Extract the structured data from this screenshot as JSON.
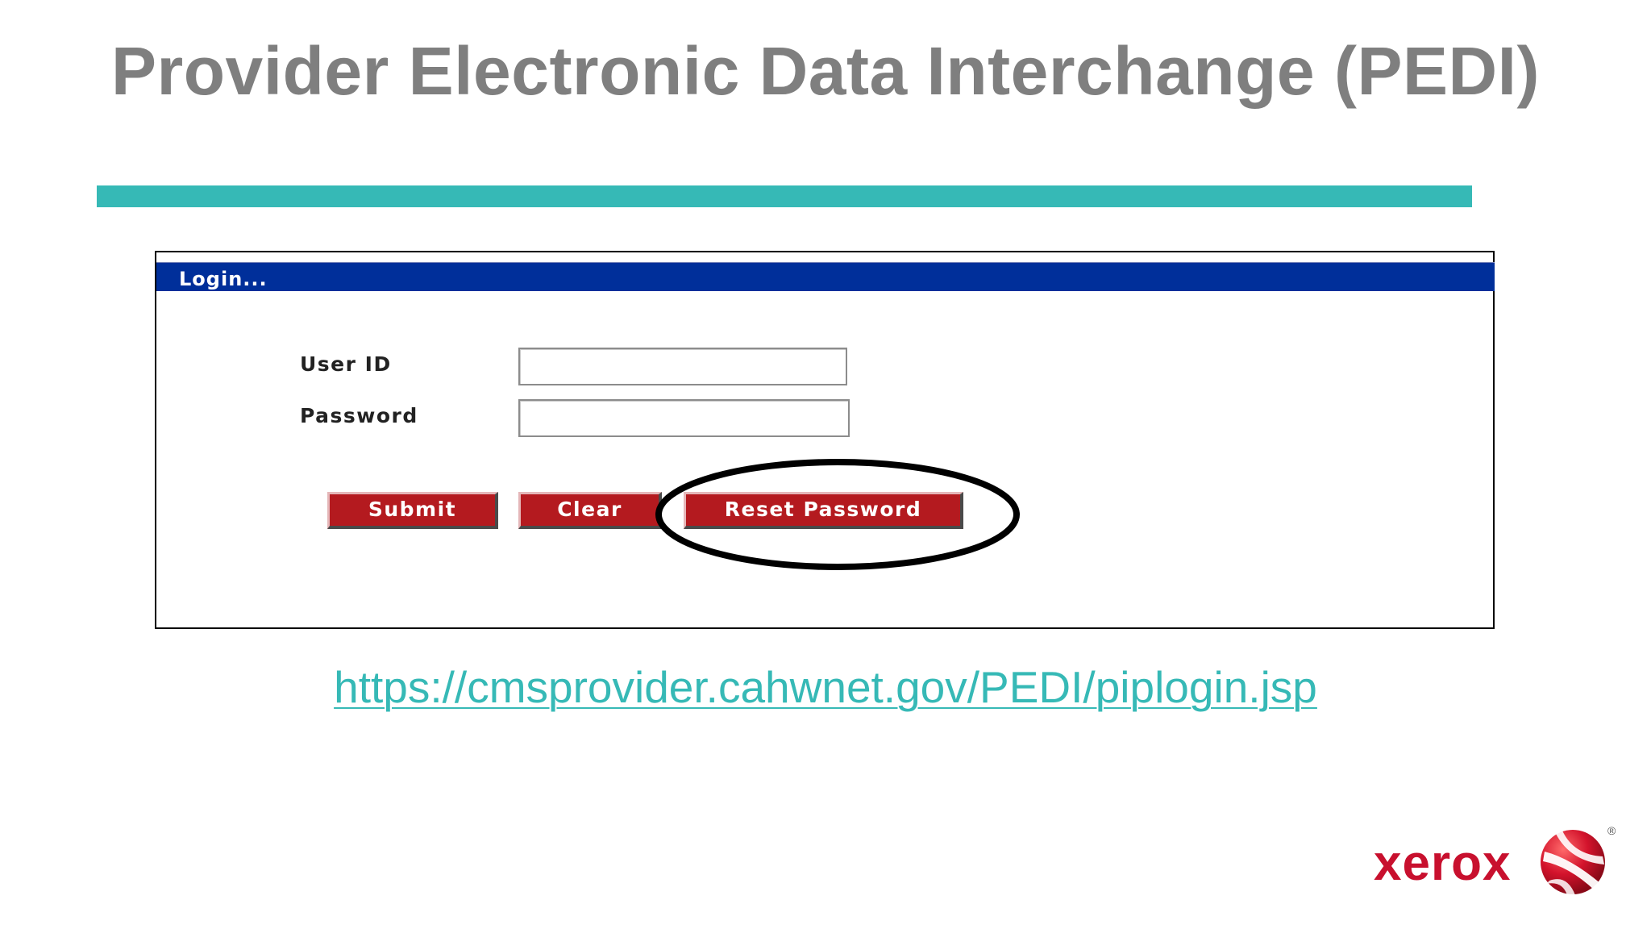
{
  "slide": {
    "title": "Provider Electronic Data Interchange (PEDI)",
    "link_text": "https://cmsprovider.cahwnet.gov/PEDI/piplogin.jsp",
    "logo_text": "xerox",
    "logo_registered": "®"
  },
  "login_form": {
    "header": "Login...",
    "fields": [
      {
        "label": "User ID",
        "value": ""
      },
      {
        "label": "Password",
        "value": ""
      }
    ],
    "buttons": {
      "submit": "Submit",
      "clear": "Clear",
      "reset_password": "Reset Password"
    }
  },
  "colors": {
    "title_gray": "#7f7f7f",
    "accent_teal": "#36b9b6",
    "login_header_blue": "#002f9a",
    "button_red": "#b41a1f",
    "brand_red": "#c8102e"
  },
  "icons": {
    "logo": "xerox-sphere-icon",
    "highlight": "highlight-ellipse"
  }
}
